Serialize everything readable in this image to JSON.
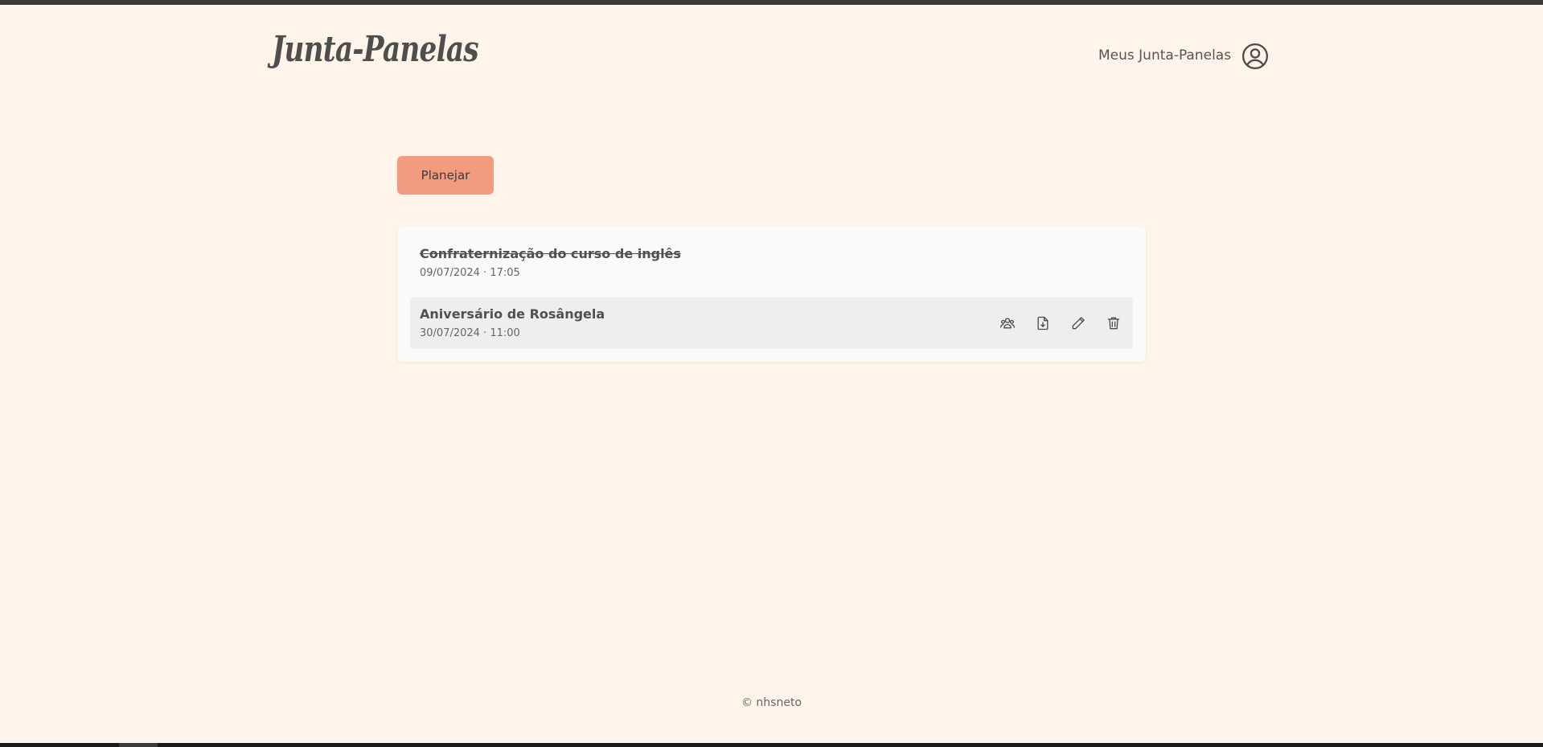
{
  "header": {
    "logo": "Junta-Panelas",
    "nav_link": "Meus Junta-Panelas",
    "user_icon": "user-circle-icon"
  },
  "main": {
    "plan_button": "Planejar",
    "events": [
      {
        "title": "Confraternização do curso de inglês",
        "date": "09/07/2024 · 17:05",
        "status": "past"
      },
      {
        "title": "Aniversário de Rosângela",
        "date": "30/07/2024 · 11:00",
        "status": "active",
        "actions": [
          "participants-icon",
          "download-file-icon",
          "edit-pencil-icon",
          "delete-trash-icon"
        ]
      }
    ]
  },
  "footer": {
    "copyright": "© nhsneto"
  },
  "colors": {
    "background": "#fef4ea",
    "accent_button": "#f19c7f",
    "card": "#fafafa",
    "active_row": "#eeeeee",
    "text": "#4a4a4a"
  }
}
